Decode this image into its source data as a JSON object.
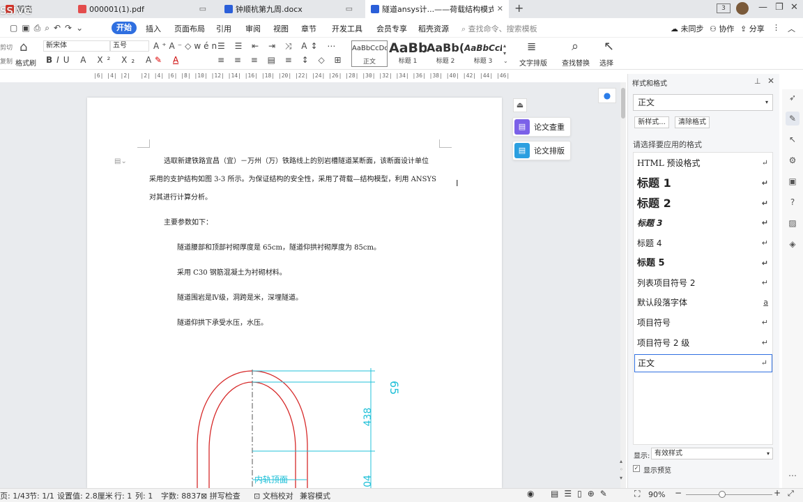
{
  "tabs": [
    {
      "label": "稻壳",
      "icon_color": "#d93025"
    },
    {
      "label": "000001(1).pdf",
      "icon_color": "#e34c4c"
    },
    {
      "label": "钟顺杭第九周.docx",
      "icon_color": "#2b5fd9"
    },
    {
      "label": "隧道ansys计...——荷载结构模式",
      "icon_color": "#2b5fd9"
    }
  ],
  "overlay_text": "ssive",
  "menu": {
    "start": "开始",
    "items": [
      "插入",
      "页面布局",
      "引用",
      "审阅",
      "视图",
      "章节",
      "开发工具",
      "会员专享",
      "稻壳资源"
    ],
    "search": "查找命令、搜索模板",
    "sync": "未同步",
    "collab": "协作",
    "share": "分享"
  },
  "ribbon": {
    "cut": "剪切",
    "copy": "复制",
    "format_painter": "格式刷",
    "font_name": "新宋体",
    "font_size": "五号",
    "styles": [
      {
        "preview": "AaBbCcDd",
        "label": "正文"
      },
      {
        "preview": "AaBb",
        "label": "标题 1"
      },
      {
        "preview": "AaBb(",
        "label": "标题 2"
      },
      {
        "preview": "AaBbCcL",
        "label": "标题 3"
      }
    ],
    "text_layout": "文字排版",
    "find_replace": "查找替换",
    "select": "选择"
  },
  "ruler_text": "|6| |4| |2|   |2| |4| |6| |8| |10| |12| |14| |16| |18| |20| |22| |24| |26| |28| |30| |32| |34| |36| |38| |40| |42| |44| |46|",
  "doc": {
    "p1_line1": "选取新建铁路宜昌（宜）－万州（万）铁路线上的别岩槽隧道某断面，该断面设计单位",
    "p1_line2": "采用的支护结构如图 3-3 所示。为保证结构的安全性，采用了荷载—结构模型，利用 ANSYS",
    "p1_line3": "对其进行计算分析。",
    "p2": "主要参数如下：",
    "b1": "隧道腰部和顶部衬砌厚度是 65cm，隧道仰拱衬砌厚度为 85cm。",
    "b2": "采用 C30 钢筋混凝土为衬砌材料。",
    "b3": "隧道围岩是Ⅳ级，洞跨是米，深埋隧道。",
    "b4": "隧道仰拱下承受水压，水压。"
  },
  "drawing": {
    "dim_top": "65",
    "dim_mid": "438",
    "dim_bottom": "04",
    "centre_label": "内轨顶面"
  },
  "side_buttons": {
    "check": "论文查重",
    "layout": "论文排版"
  },
  "pane": {
    "title": "样式和格式",
    "current": "正文",
    "new_style": "新样式...",
    "clear_format": "清除格式",
    "prompt": "请选择要应用的格式",
    "styles": [
      "HTML 预设格式",
      "标题 1",
      "标题 2",
      "标题 3",
      "标题 4",
      "标题 5",
      "列表项目符号 2",
      "默认段落字体",
      "项目符号",
      "项目符号 2 级",
      "正文"
    ],
    "show_label": "显示:",
    "show_value": "有效样式",
    "preview_label": "显示预览"
  },
  "status": {
    "page": "页: 1/43",
    "section": "节: 1/1",
    "setting": "设置值: 2.8厘米",
    "row": "行: 1",
    "col": "列: 1",
    "words": "字数: 8837",
    "spell": "拼写检查",
    "proof": "文档校对",
    "compat": "兼容模式",
    "zoom": "90%"
  }
}
